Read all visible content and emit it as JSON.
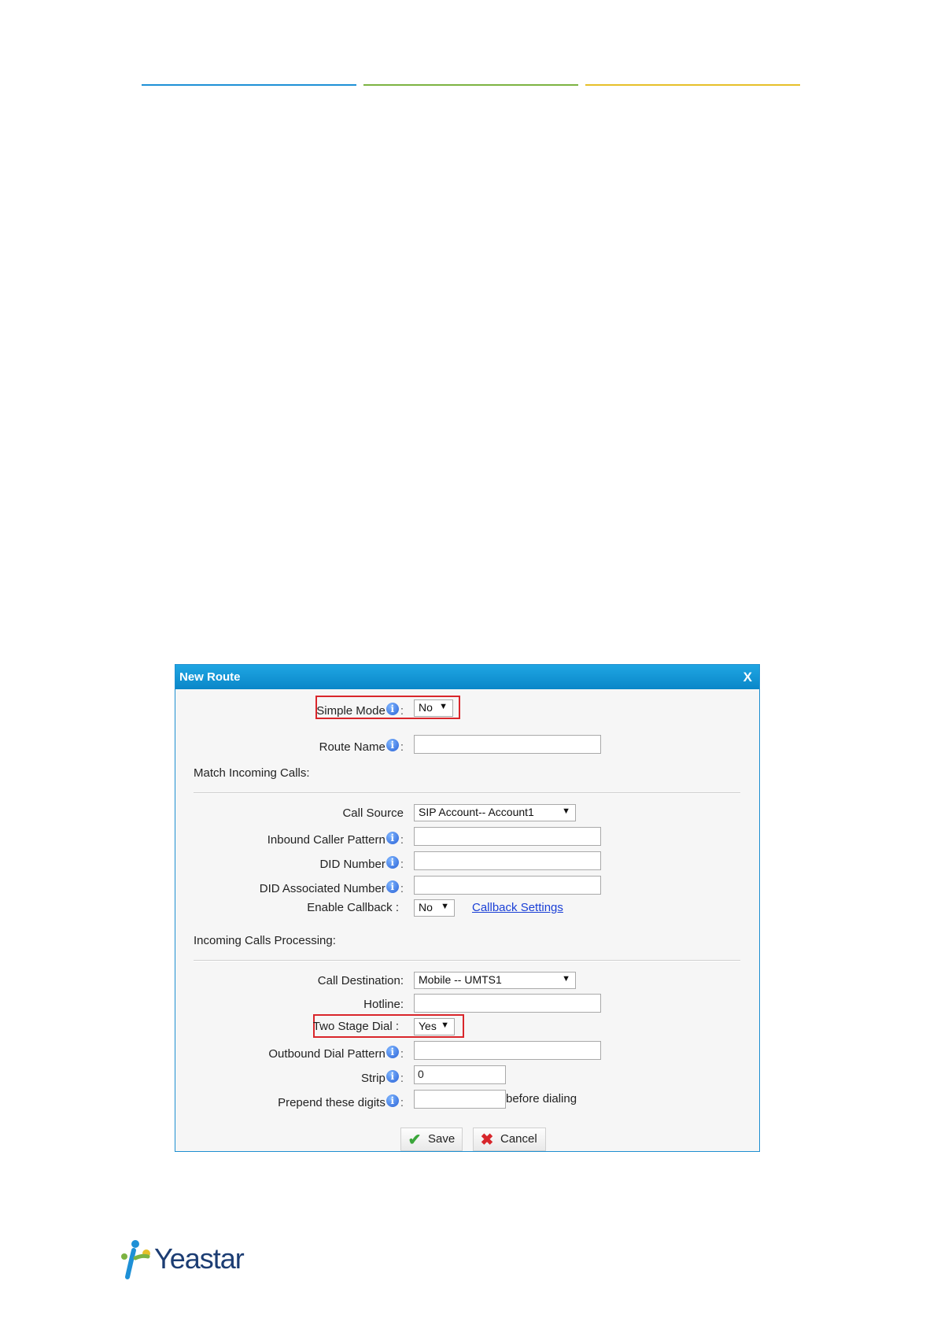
{
  "dialog": {
    "title": "New Route",
    "close": "X",
    "simple_mode": {
      "label": "Simple Mode",
      "value": "No"
    },
    "route_name": {
      "label": "Route Name",
      "value": ""
    },
    "match_section": "Match Incoming Calls:",
    "call_source": {
      "label": "Call Source",
      "value": "SIP Account-- Account1"
    },
    "inbound_caller_pattern": {
      "label": "Inbound Caller Pattern",
      "value": ""
    },
    "did_number": {
      "label": "DID Number",
      "value": ""
    },
    "did_associated_number": {
      "label": "DID Associated Number",
      "value": ""
    },
    "enable_callback": {
      "label": "Enable Callback :",
      "value": "No",
      "link": "Callback Settings"
    },
    "processing_section": "Incoming Calls Processing:",
    "call_destination": {
      "label": "Call Destination:",
      "value": "Mobile -- UMTS1"
    },
    "hotline": {
      "label": "Hotline:",
      "value": ""
    },
    "two_stage_dial": {
      "label": "Two Stage Dial :",
      "value": "Yes"
    },
    "outbound_dial_pattern": {
      "label": "Outbound Dial Pattern",
      "value": ""
    },
    "strip": {
      "label": "Strip",
      "value": "0"
    },
    "prepend": {
      "label": "Prepend these digits",
      "value": "",
      "suffix": "before dialing"
    },
    "save": "Save",
    "cancel": "Cancel"
  },
  "logo": {
    "text": "Yeastar"
  },
  "colors": {
    "accent": "#1e90d6",
    "highlight": "#d9262b",
    "link": "#1a3fd6"
  }
}
